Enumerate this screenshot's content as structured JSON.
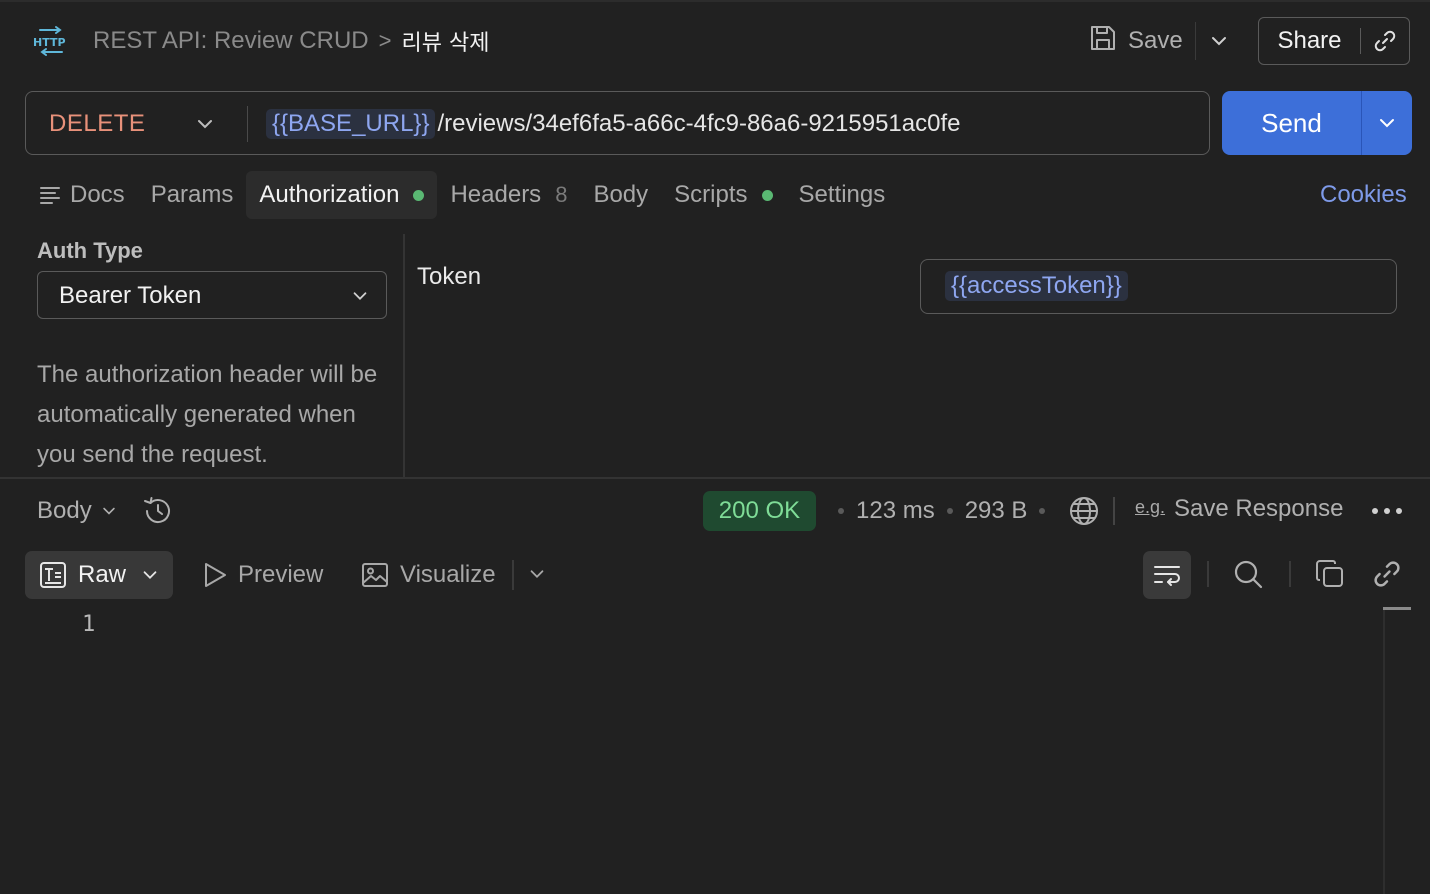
{
  "header": {
    "collection": "REST API: Review CRUD",
    "separator": ">",
    "request_name": "리뷰 삭제",
    "save_label": "Save",
    "share_label": "Share"
  },
  "request": {
    "method": "DELETE",
    "url_variable": "{{BASE_URL}}",
    "url_path": "/reviews/34ef6fa5-a66c-4fc9-86a6-9215951ac0fe",
    "send_label": "Send"
  },
  "tabs": [
    {
      "label": "Docs"
    },
    {
      "label": "Params"
    },
    {
      "label": "Authorization"
    },
    {
      "label": "Headers",
      "count": "8"
    },
    {
      "label": "Body"
    },
    {
      "label": "Scripts"
    },
    {
      "label": "Settings"
    }
  ],
  "cookies_label": "Cookies",
  "auth": {
    "type_label": "Auth Type",
    "type_value": "Bearer Token",
    "help_text": "The authorization header will be automatically generated when you send the request.",
    "token_label": "Token",
    "token_value": "{{accessToken}}"
  },
  "response": {
    "body_select": "Body",
    "status": "200 OK",
    "time": "123 ms",
    "size": "293 B",
    "eg_label": "e.g.",
    "save_response": "Save Response",
    "views": {
      "raw": "Raw",
      "preview": "Preview",
      "visualize": "Visualize"
    },
    "line_numbers": [
      "1"
    ]
  },
  "colors": {
    "background": "#212121",
    "method_delete": "#e8917a",
    "send_button": "#3d6fd9",
    "status_ok_bg": "#1f4a30",
    "status_ok_text": "#7fdc97",
    "variable": "#8ea6f0",
    "dot_green": "#5ab873",
    "link_blue": "#7e9ae8"
  },
  "icons": [
    "http-icon",
    "save-icon",
    "chevron-down-icon",
    "link-icon",
    "docs-icon",
    "history-icon",
    "globe-icon",
    "more-icon",
    "raw-icon",
    "play-icon",
    "image-icon",
    "wrap-icon",
    "search-icon",
    "copy-icon"
  ]
}
